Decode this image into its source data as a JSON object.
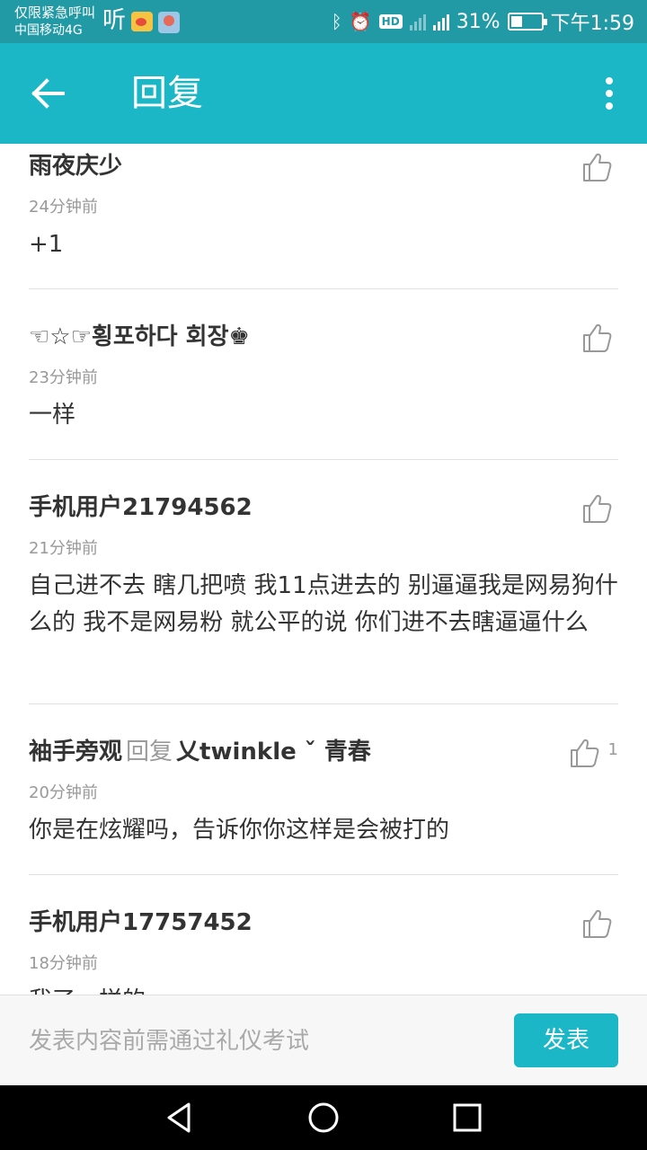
{
  "status_bar": {
    "carrier_line1": "仅限紧急呼叫",
    "carrier_line2": "中国移动4G",
    "ting_label": "听",
    "icons": [
      "weibo-icon",
      "app-icon",
      "bluetooth-icon",
      "alarm-icon",
      "hd-icon",
      "signal-icon",
      "battery-icon"
    ],
    "hd_label": "HD",
    "battery_percent": "31%",
    "time": "下午1:59"
  },
  "app_bar": {
    "title": "回复",
    "background": "#1bb7c6"
  },
  "comments": [
    {
      "author": "雨夜庆少",
      "reply_word": "",
      "reply_to": "",
      "time": "24分钟前",
      "body": "+1",
      "likes": ""
    },
    {
      "author": "☜☆☞횡포하다 회장♚",
      "reply_word": "",
      "reply_to": "",
      "time": "23分钟前",
      "body": "一样",
      "likes": ""
    },
    {
      "author": "手机用户21794562",
      "reply_word": "",
      "reply_to": "",
      "time": "21分钟前",
      "body": "自己进不去 瞎几把喷 我11点进去的 别逼逼我是网易狗什么的 我不是网易粉 就公平的说 你们进不去瞎逼逼什么",
      "likes": ""
    },
    {
      "author": "袖手旁观",
      "reply_word": "回复",
      "reply_to": "乂twinkle ˇ 青春",
      "time": "20分钟前",
      "body": "你是在炫耀吗，告诉你你这样是会被打的",
      "likes": "1"
    },
    {
      "author": "手机用户17757452",
      "reply_word": "",
      "reply_to": "",
      "time": "18分钟前",
      "body": "我了一样的",
      "likes": ""
    }
  ],
  "compose": {
    "placeholder": "发表内容前需通过礼仪考试",
    "publish_label": "发表"
  },
  "nav": {
    "icons": [
      "back-triangle-icon",
      "home-circle-icon",
      "recents-square-icon"
    ]
  }
}
